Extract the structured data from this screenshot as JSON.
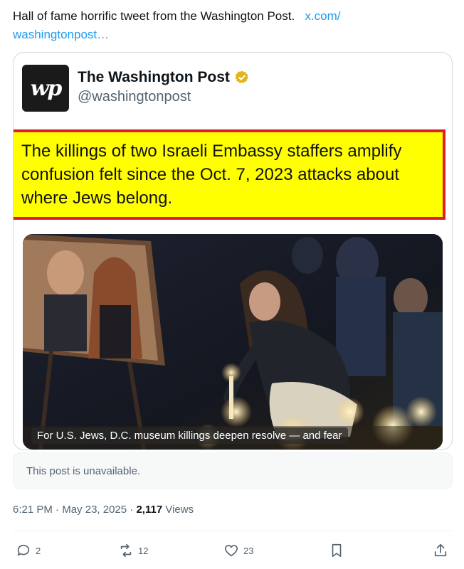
{
  "post": {
    "text": "Hall of fame horrific tweet from the Washington Post.",
    "link": "x.com/\nwashingtonpost…"
  },
  "quote": {
    "display_name": "The Washington Post",
    "handle": "@washingtonpost",
    "logo_text": "wp",
    "headline": "The killings of two Israeli Embassy staffers amplify confusion felt since the Oct. 7, 2023 attacks about where Jews belong.",
    "media_caption": "For U.S. Jews, D.C. museum killings deepen resolve — and fear"
  },
  "unavailable_text": "This post is unavailable.",
  "meta": {
    "time": "6:21 PM",
    "date": "May 23, 2025",
    "views_count": "2,117",
    "views_label": "Views"
  },
  "actions": {
    "replies": "2",
    "reposts": "12",
    "likes": "23"
  },
  "colors": {
    "link": "#1d9bf0",
    "highlight": "#ffff00",
    "highlight_border": "#e11d2a",
    "verified": "#e2b719"
  }
}
